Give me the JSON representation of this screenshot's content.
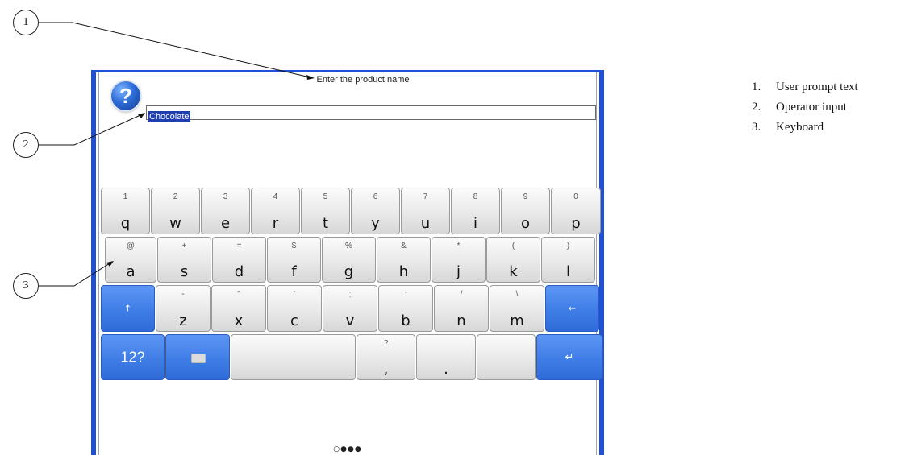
{
  "prompt": {
    "text": "Enter the product name"
  },
  "input": {
    "value": "Chocolate"
  },
  "keyboard": {
    "row1": [
      {
        "sec": "1",
        "pri": "q"
      },
      {
        "sec": "2",
        "pri": "w"
      },
      {
        "sec": "3",
        "pri": "e"
      },
      {
        "sec": "4",
        "pri": "r"
      },
      {
        "sec": "5",
        "pri": "t"
      },
      {
        "sec": "6",
        "pri": "y"
      },
      {
        "sec": "7",
        "pri": "u"
      },
      {
        "sec": "8",
        "pri": "i"
      },
      {
        "sec": "9",
        "pri": "o"
      },
      {
        "sec": "0",
        "pri": "p"
      }
    ],
    "row2": [
      {
        "sec": "@",
        "pri": "a"
      },
      {
        "sec": "+",
        "pri": "s"
      },
      {
        "sec": "=",
        "pri": "d"
      },
      {
        "sec": "$",
        "pri": "f"
      },
      {
        "sec": "%",
        "pri": "g"
      },
      {
        "sec": "&",
        "pri": "h"
      },
      {
        "sec": "*",
        "pri": "j"
      },
      {
        "sec": "(",
        "pri": "k"
      },
      {
        "sec": ")",
        "pri": "l"
      }
    ],
    "row3": [
      {
        "sec": "-",
        "pri": "z"
      },
      {
        "sec": "\"",
        "pri": "x"
      },
      {
        "sec": "'",
        "pri": "c"
      },
      {
        "sec": ";",
        "pri": "v"
      },
      {
        "sec": ":",
        "pri": "b"
      },
      {
        "sec": "/",
        "pri": "n"
      },
      {
        "sec": "\\",
        "pri": "m"
      }
    ],
    "shift_glyph": "↑",
    "backspace_glyph": "←",
    "mode_label": "12?",
    "comma": {
      "sec": "?",
      "pri": ","
    },
    "period": {
      "pri": "."
    },
    "enter_glyph": "↵"
  },
  "pager": {
    "text": "○●●●"
  },
  "callouts": [
    "1",
    "2",
    "3"
  ],
  "legend": [
    {
      "num": "1.",
      "text": "User prompt text"
    },
    {
      "num": "2.",
      "text": "Operator input"
    },
    {
      "num": "3.",
      "text": "Keyboard"
    }
  ],
  "colors": {
    "frame": "#1e4fd6",
    "accent_key": "#3f7de6",
    "selection": "#1f3fb0"
  },
  "icons": {
    "help": "question-mark-icon",
    "keyboard": "keyboard-hide-icon"
  }
}
